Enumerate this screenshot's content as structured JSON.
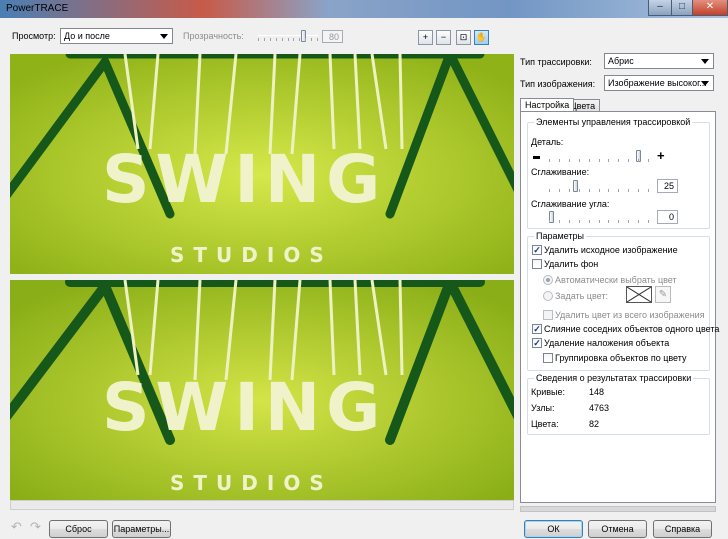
{
  "window": {
    "title": "PowerTRACE",
    "minimize": "–",
    "maximize": "□",
    "close": "✕"
  },
  "toolbar": {
    "view_label": "Просмотр:",
    "view_value": "До и после",
    "transparency_label": "Прозрачность:",
    "transparency_value": "80",
    "transparency_level": 0.8,
    "tools": [
      {
        "name": "zoom-in-icon",
        "glyph": "+"
      },
      {
        "name": "zoom-out-icon",
        "glyph": "−"
      },
      {
        "name": "fit-icon",
        "glyph": "⊡"
      },
      {
        "name": "pan-hand-icon",
        "glyph": "✋"
      }
    ]
  },
  "preview": {
    "top_word": "SWING",
    "bottom_word": "STUDIOS",
    "bg_color": "#a8c81f",
    "frame_color": "#16571a",
    "letter_color": "#f0f3c9"
  },
  "trace_settings": {
    "trace_type_label": "Тип трассировки:",
    "trace_type_value": "Абрис",
    "image_type_label": "Тип изображения:",
    "image_type_value": "Изображение высоког..."
  },
  "tabs": [
    {
      "label": "Настройка",
      "active": true
    },
    {
      "label": "Цвета",
      "active": false
    }
  ],
  "controls_group": {
    "title": "Элементы управления трассировкой",
    "detail_label": "Деталь:",
    "detail_minus": "−",
    "detail_plus": "+",
    "detail_level": 0.93,
    "smoothing_label": "Сглаживание:",
    "smoothing_value": "25",
    "corner_label": "Сглаживание угла:",
    "corner_value": "0"
  },
  "params_group": {
    "title": "Параметры",
    "delete_original": {
      "label": "Удалить исходное изображение",
      "checked": true
    },
    "remove_bg": {
      "label": "Удалить фон",
      "checked": false
    },
    "auto_color": {
      "label": "Автоматически выбрать цвет"
    },
    "set_color": {
      "label": "Задать цвет:"
    },
    "remove_all_color": {
      "label": "Удалить цвет из всего изображения"
    },
    "merge_adjacent": {
      "label": "Слияние соседних объектов одного цвета",
      "checked": true
    },
    "remove_overlap": {
      "label": "Удаление наложения объекта",
      "checked": true
    },
    "group_by_color": {
      "label": "Группировка объектов по цвету",
      "checked": false
    }
  },
  "results_group": {
    "title": "Сведения о результатах трассировки",
    "curves_label": "Кривые:",
    "curves_value": "148",
    "nodes_label": "Узлы:",
    "nodes_value": "4763",
    "colors_label": "Цвета:",
    "colors_value": "82"
  },
  "footer": {
    "undo_glyph": "↶",
    "redo_glyph": "↷",
    "reset": "Сброс",
    "options": "Параметры...",
    "ok": "ОК",
    "cancel": "Отмена",
    "help": "Справка"
  }
}
